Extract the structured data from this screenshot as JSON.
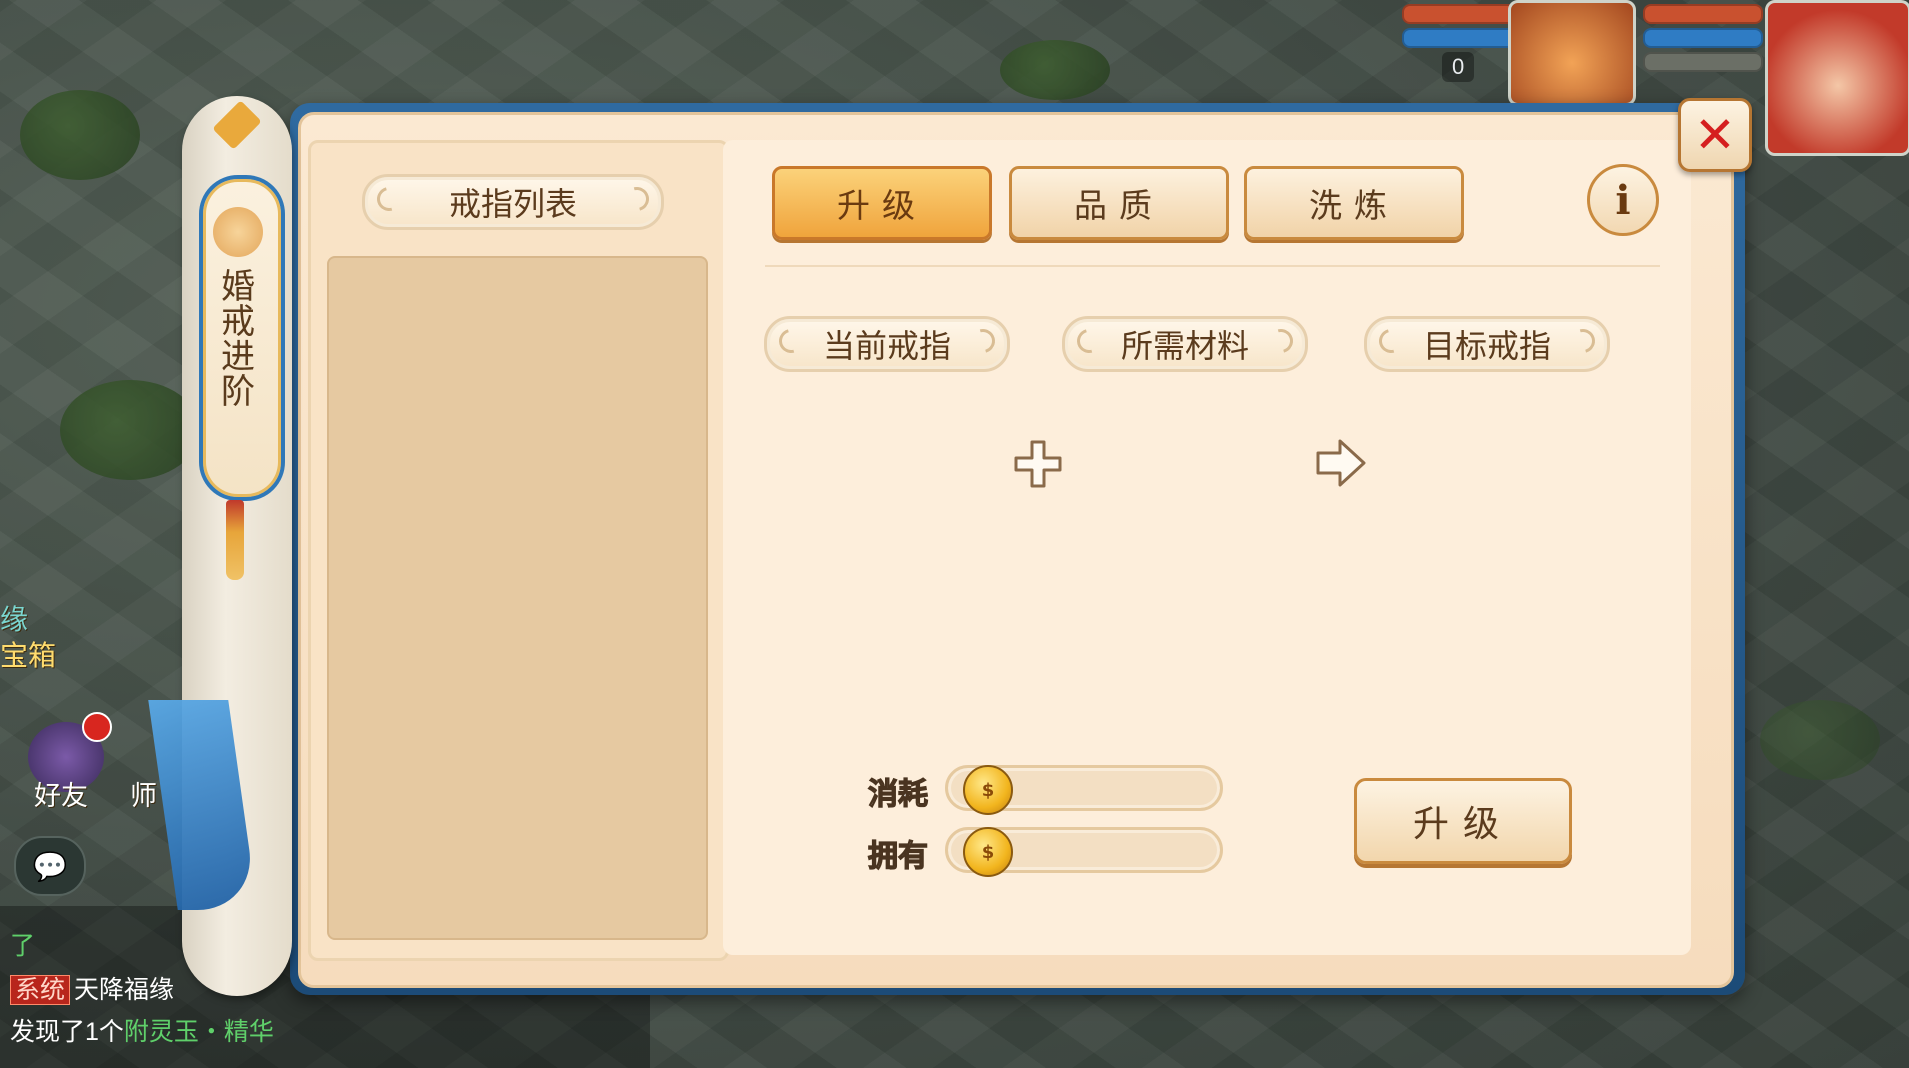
{
  "hud": {
    "counter": "0"
  },
  "side": {
    "label_line1": "缘",
    "label_line2": "宝箱",
    "friends_label": "好友",
    "master_label": "师"
  },
  "chat": {
    "line1": "了",
    "system_tag": "系统",
    "line2_text": "天降福缘",
    "line3_prefix": "发现了1个",
    "line3_item": "附灵玉・精华"
  },
  "scroll_tab": {
    "title": "婚戒进阶"
  },
  "panel": {
    "ring_list_header": "戒指列表",
    "tabs": [
      {
        "label": "升级",
        "active": true
      },
      {
        "label": "品质",
        "active": false
      },
      {
        "label": "洗炼",
        "active": false
      }
    ],
    "info_symbol": "i",
    "close_symbol": "✕",
    "headers": {
      "current_ring": "当前戒指",
      "materials": "所需材料",
      "target_ring": "目标戒指"
    },
    "cost": {
      "consume_label": "消耗",
      "own_label": "拥有",
      "consume_value": "",
      "own_value": ""
    },
    "upgrade_button": "升级"
  },
  "colors": {
    "accent": "#f0a43c",
    "close_red": "#d51f1f",
    "frame_blue": "#2f6aa0",
    "parchment": "#fbe9d2"
  }
}
